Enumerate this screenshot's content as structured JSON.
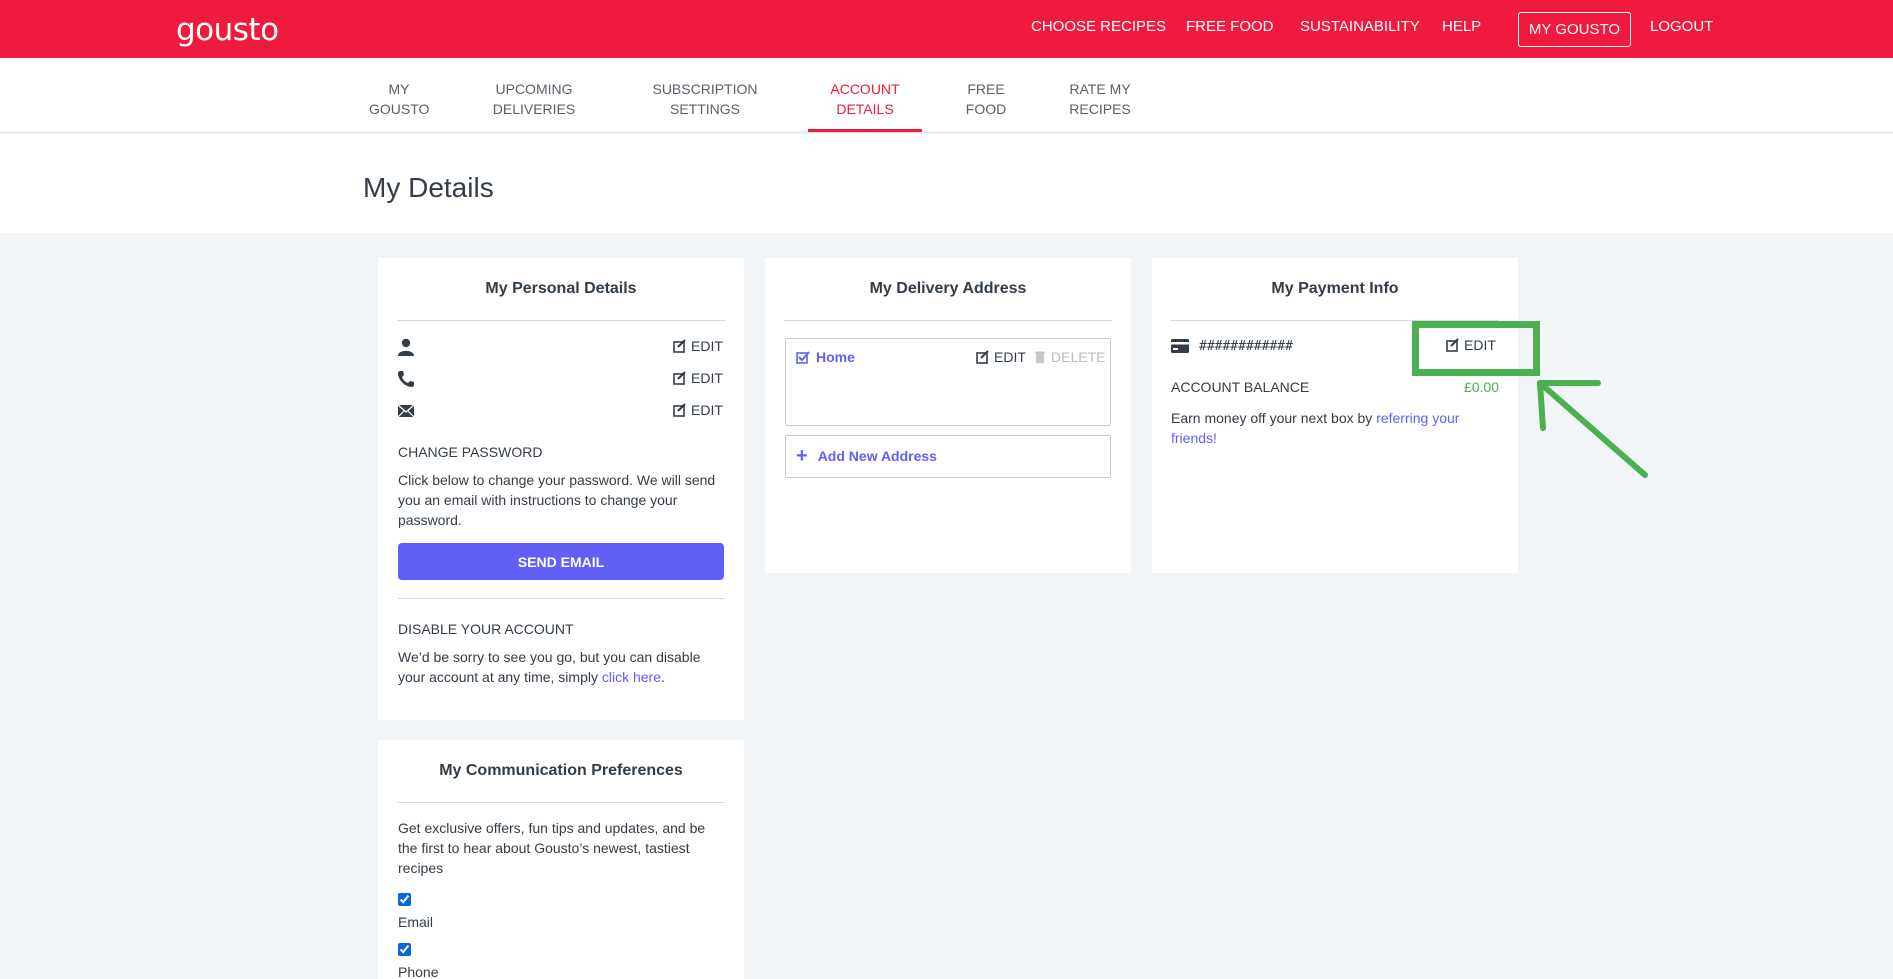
{
  "header": {
    "logo": "gousto",
    "nav": {
      "choose_recipes": "CHOOSE RECIPES",
      "free_food": "FREE FOOD",
      "sustainability": "SUSTAINABILITY",
      "help": "HELP",
      "my_gousto": "MY GOUSTO",
      "logout": "LOGOUT"
    },
    "colors": {
      "brand": "#f0193e",
      "accent": "#6160f6",
      "success": "#4caf50"
    }
  },
  "subnav": {
    "tabs": [
      {
        "line1": "MY",
        "line2": "GOUSTO"
      },
      {
        "line1": "UPCOMING",
        "line2": "DELIVERIES"
      },
      {
        "line1": "SUBSCRIPTION",
        "line2": "SETTINGS"
      },
      {
        "line1": "ACCOUNT",
        "line2": "DETAILS"
      },
      {
        "line1": "FREE",
        "line2": "FOOD"
      },
      {
        "line1": "RATE MY",
        "line2": "RECIPES"
      }
    ],
    "active_tab": "ACCOUNT DETAILS"
  },
  "page": {
    "title": "My Details"
  },
  "personal": {
    "title": "My Personal Details",
    "edit_label": "EDIT",
    "icons": [
      "user-icon",
      "phone-icon",
      "envelope-icon"
    ],
    "change_password_label": "CHANGE PASSWORD",
    "change_password_text": "Click below to change your password. We will send you an email with instructions to change your password.",
    "send_email": "SEND EMAIL",
    "disable_label": "DISABLE YOUR ACCOUNT",
    "disable_text": "We’d be sorry to see you go, but you can disable your account at any time, simply ",
    "disable_link": "click here",
    "disable_end": "."
  },
  "delivery": {
    "title": "My Delivery Address",
    "address_name": "Home",
    "edit_label": "EDIT",
    "delete_label": "DELETE",
    "add_new": "Add New Address"
  },
  "payment": {
    "title": "My Payment Info",
    "card_mask": "############",
    "edit_label": "EDIT",
    "balance_label": "ACCOUNT BALANCE",
    "balance_value": "£0.00",
    "referral_text": "Earn money off your next box by ",
    "referral_link": "referring your friends",
    "referral_end": "!"
  },
  "communication": {
    "title": "My Communication Preferences",
    "intro": "Get exclusive offers, fun tips and updates, and be the first to hear about Gousto’s newest, tastiest recipes",
    "options": [
      {
        "label": "Email",
        "checked": true
      },
      {
        "label": "Phone",
        "checked": true
      }
    ]
  }
}
